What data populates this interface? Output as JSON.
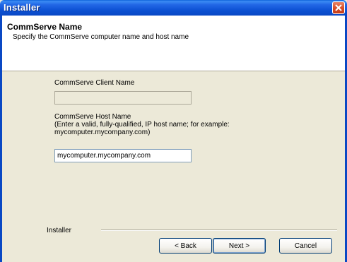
{
  "window": {
    "title": "Installer"
  },
  "header": {
    "title": "CommServe Name",
    "subtitle": "Specify the CommServe computer name and host name"
  },
  "form": {
    "client_name_label": "CommServe Client Name",
    "client_name_value": "",
    "host_name_label": "CommServe Host Name",
    "host_name_hint": "(Enter a valid, fully-qualified, IP host name; for example: mycomputer.mycompany.com)",
    "host_name_value": "mycomputer.mycompany.com"
  },
  "footer": {
    "label": "Installer",
    "back_label": "< Back",
    "next_label": "Next >",
    "cancel_label": "Cancel"
  },
  "icons": {
    "close": "close-icon"
  }
}
